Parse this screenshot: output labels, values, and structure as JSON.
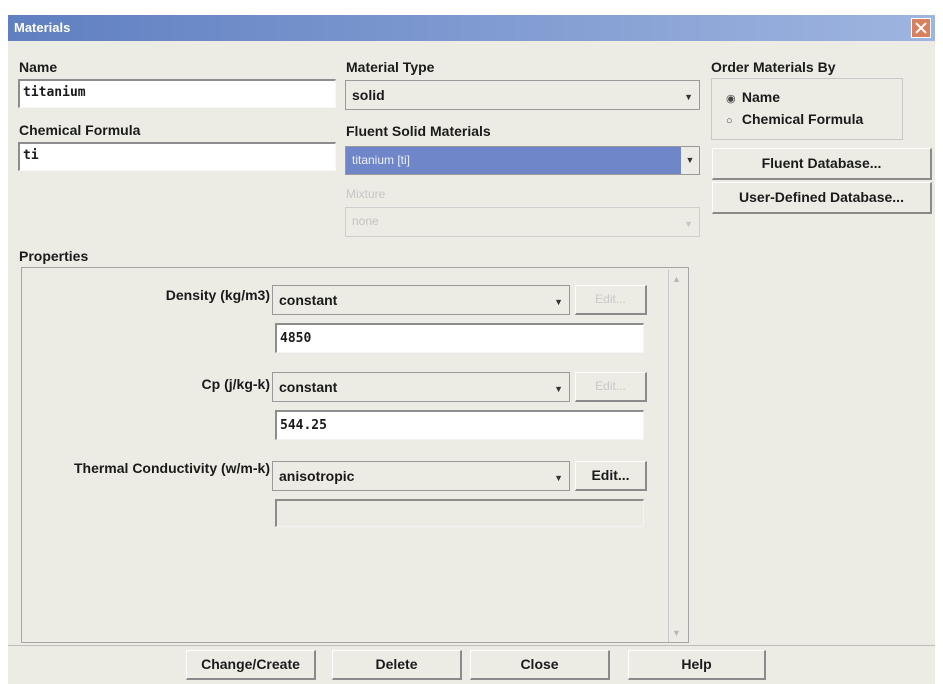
{
  "window": {
    "title": "Materials"
  },
  "name": {
    "label": "Name",
    "value": "titanium"
  },
  "formula": {
    "label": "Chemical Formula",
    "value": "ti"
  },
  "material_type": {
    "label": "Material Type",
    "value": "solid"
  },
  "fluent_solid": {
    "label": "Fluent Solid Materials",
    "value": "titanium [ti]"
  },
  "mixture": {
    "label": "Mixture",
    "value": "none"
  },
  "order": {
    "label": "Order Materials By",
    "options": [
      "Name",
      "Chemical Formula"
    ],
    "selected": "Name"
  },
  "buttons_right": {
    "fluent_db": "Fluent Database...",
    "user_db": "User-Defined Database..."
  },
  "properties": {
    "label": "Properties",
    "rows": [
      {
        "label": "Density (kg/m3)",
        "method": "constant",
        "edit": "Edit...",
        "value": "4850"
      },
      {
        "label": "Cp (j/kg-k)",
        "method": "constant",
        "edit": "Edit...",
        "value": "544.25"
      },
      {
        "label": "Thermal Conductivity (w/m-k)",
        "method": "anisotropic",
        "edit": "Edit...",
        "value": ""
      }
    ]
  },
  "footer": {
    "change": "Change/Create",
    "delete": "Delete",
    "close": "Close",
    "help": "Help"
  }
}
